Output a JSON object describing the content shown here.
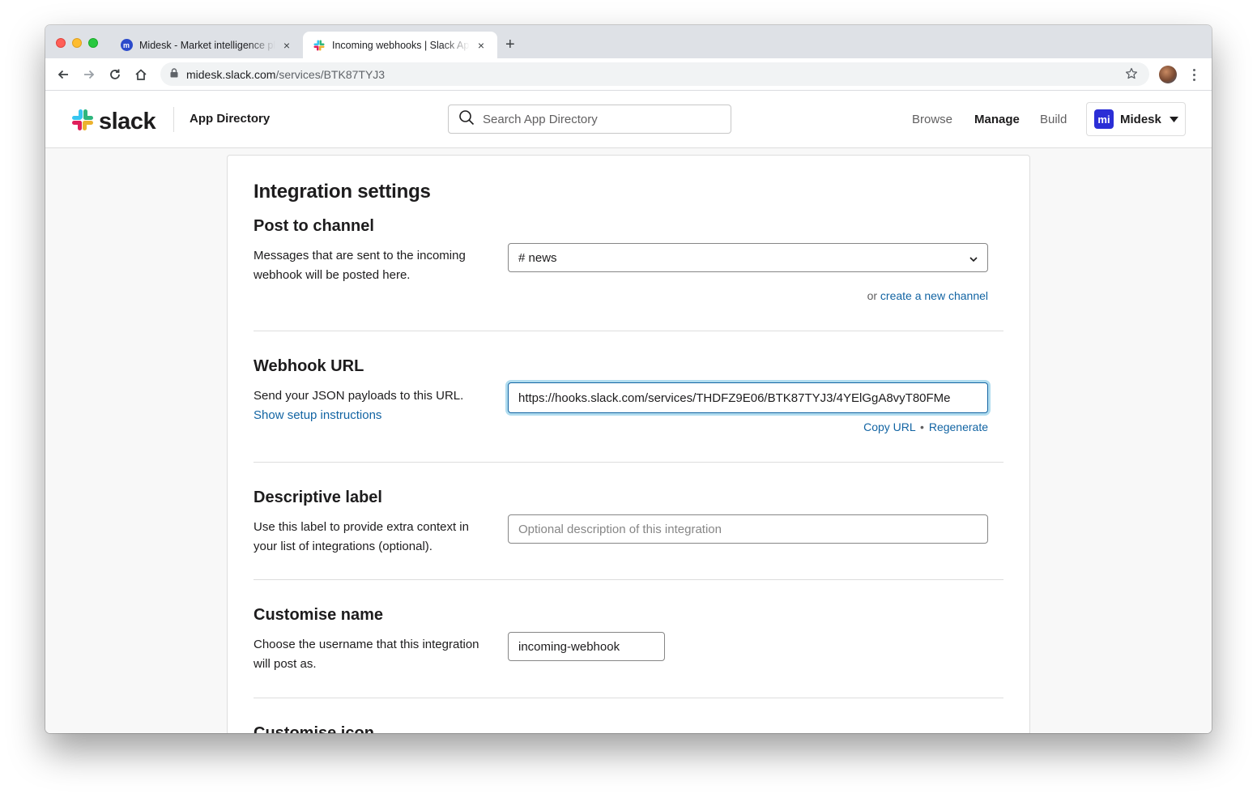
{
  "browser": {
    "tabs": [
      {
        "title": "Midesk - Market intelligence platform",
        "favicon": "midesk-favicon-icon",
        "active": false
      },
      {
        "title": "Incoming webhooks | Slack App Directory",
        "favicon": "slack-favicon-icon",
        "active": true
      }
    ],
    "close_glyph": "×",
    "new_tab_glyph": "+",
    "url_host": "midesk.slack.com",
    "url_path": "/services/BTK87TYJ3"
  },
  "header": {
    "brand": "slack",
    "app_directory": "App Directory",
    "search_placeholder": "Search App Directory",
    "nav": {
      "browse": "Browse",
      "manage": "Manage",
      "build": "Build"
    },
    "workspace": {
      "logo_text": "mi",
      "name": "Midesk"
    }
  },
  "page": {
    "title": "Integration settings",
    "post_to_channel": {
      "title": "Post to channel",
      "description": "Messages that are sent to the incoming webhook will be posted here.",
      "selected_channel": "# news",
      "helper_prefix": "or",
      "create_link": "create a new channel"
    },
    "webhook_url": {
      "title": "Webhook URL",
      "description": "Send your JSON payloads to this URL.",
      "setup_link": "Show setup instructions",
      "value": "https://hooks.slack.com/services/THDFZ9E06/BTK87TYJ3/4YElGgA8vyT80FMe",
      "copy_link": "Copy URL",
      "separator": "•",
      "regenerate_link": "Regenerate"
    },
    "descriptive_label": {
      "title": "Descriptive label",
      "description": "Use this label to provide extra context in your list of integrations (optional).",
      "placeholder": "Optional description of this integration"
    },
    "customise_name": {
      "title": "Customise name",
      "description": "Choose the username that this integration will post as.",
      "value": "incoming-webhook"
    },
    "customise_icon": {
      "title": "Customise icon"
    }
  },
  "colors": {
    "link": "#1264a3",
    "focus_ring": "#1d9bd1",
    "workspace_logo": "#2b2ed6"
  }
}
